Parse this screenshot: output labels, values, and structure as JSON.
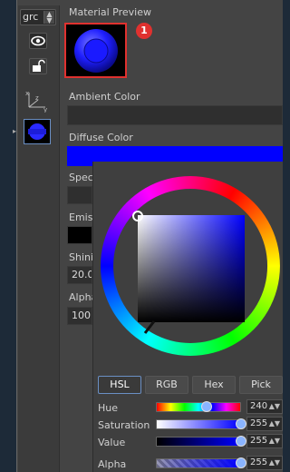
{
  "toolbar": {
    "combo_value": "grc",
    "eye_icon": "eye-icon",
    "lock_icon": "lock-icon",
    "axis_icon": "axis-xyz-icon"
  },
  "material": {
    "preview_label": "Material Preview",
    "badge": "1",
    "ambient_label": "Ambient Color",
    "diffuse_label": "Diffuse Color",
    "diffuse_color": "#0000ff",
    "specular_label": "Spec",
    "emissive_label": "Emis",
    "shininess_label": "Shini",
    "shininess_value": "20.0",
    "alpha_label": "Alpha",
    "alpha_value": "100."
  },
  "color_picker": {
    "tabs": [
      "HSL",
      "RGB",
      "Hex",
      "Pick"
    ],
    "active_tab": "HSL",
    "sliders": [
      {
        "label": "Hue",
        "value": "240",
        "fraction": 0.6
      },
      {
        "label": "Saturation",
        "value": "255",
        "fraction": 1.0
      },
      {
        "label": "Value",
        "value": "255",
        "fraction": 1.0
      },
      {
        "label": "Alpha",
        "value": "255",
        "fraction": 1.0
      }
    ]
  },
  "colors": {
    "accent_red": "#e0312f",
    "diffuse": "#0000ff"
  }
}
